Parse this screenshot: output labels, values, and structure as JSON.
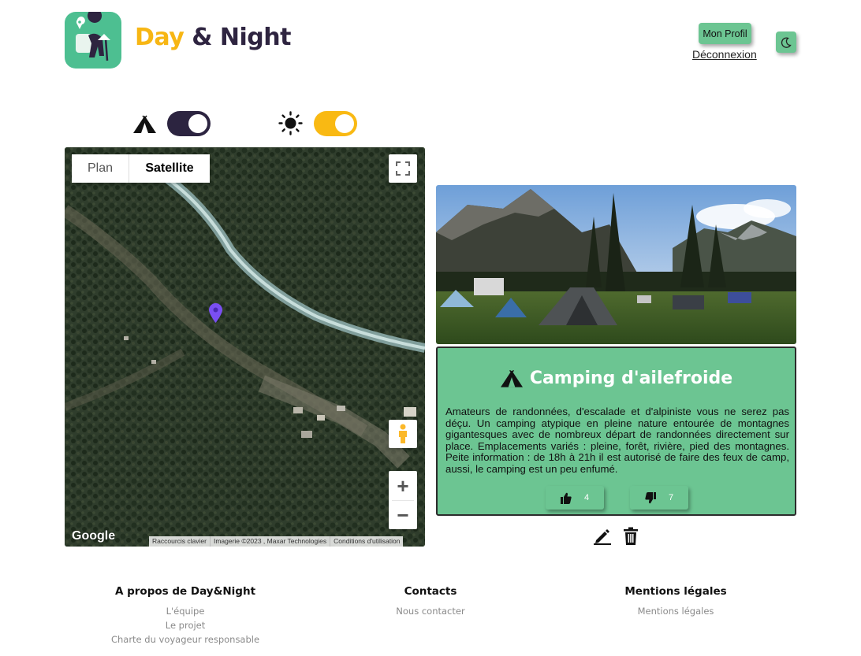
{
  "brand": {
    "name_part1": "Day",
    "name_part2": "& Night",
    "logo_icon": "hiker-with-map-pin-icon"
  },
  "header": {
    "profile_label": "Mon Profil",
    "logout_label": "Déconnexion",
    "theme_icon": "moon-icon"
  },
  "toggles": [
    {
      "icon": "tent-icon",
      "state": "on",
      "color": "#2c2440"
    },
    {
      "icon": "sun-icon",
      "state": "on",
      "color": "#f9b913"
    }
  ],
  "map": {
    "type_options": [
      "Plan",
      "Satellite"
    ],
    "selected_type": "Satellite",
    "zoom_in": "+",
    "zoom_out": "−",
    "logo": "Google",
    "attribution": [
      "Raccourcis clavier",
      "Imagerie ©2023 , Maxar Technologies",
      "Conditions d'utilisation"
    ]
  },
  "camping": {
    "title": "Camping d'ailefroide",
    "description": "Amateurs de randonnées, d'escalade et d'alpiniste vous ne serez pas déçu. Un camping atypique en pleine nature entourée de montagnes gigantesques avec de nombreux départ de randonnées directement sur place. Emplacements variés : pleine, forêt, rivière, pied des montagnes. Peite information : de 18h à 21h il est autorisé de faire des feux de camp, aussi, le camping est un peu enfumé.",
    "likes": "4",
    "dislikes": "7"
  },
  "footer": {
    "col1": {
      "title": "A propos de Day&Night",
      "links": [
        "L'équipe",
        "Le projet",
        "Charte du voyageur responsable"
      ]
    },
    "col2": {
      "title": "Contacts",
      "links": [
        "Nous contacter"
      ]
    },
    "col3": {
      "title": "Mentions légales",
      "links": [
        "Mentions légales"
      ]
    }
  },
  "colors": {
    "accent_green": "#6cc592",
    "brand_yellow": "#f7b614",
    "brand_dark": "#2e2440"
  }
}
